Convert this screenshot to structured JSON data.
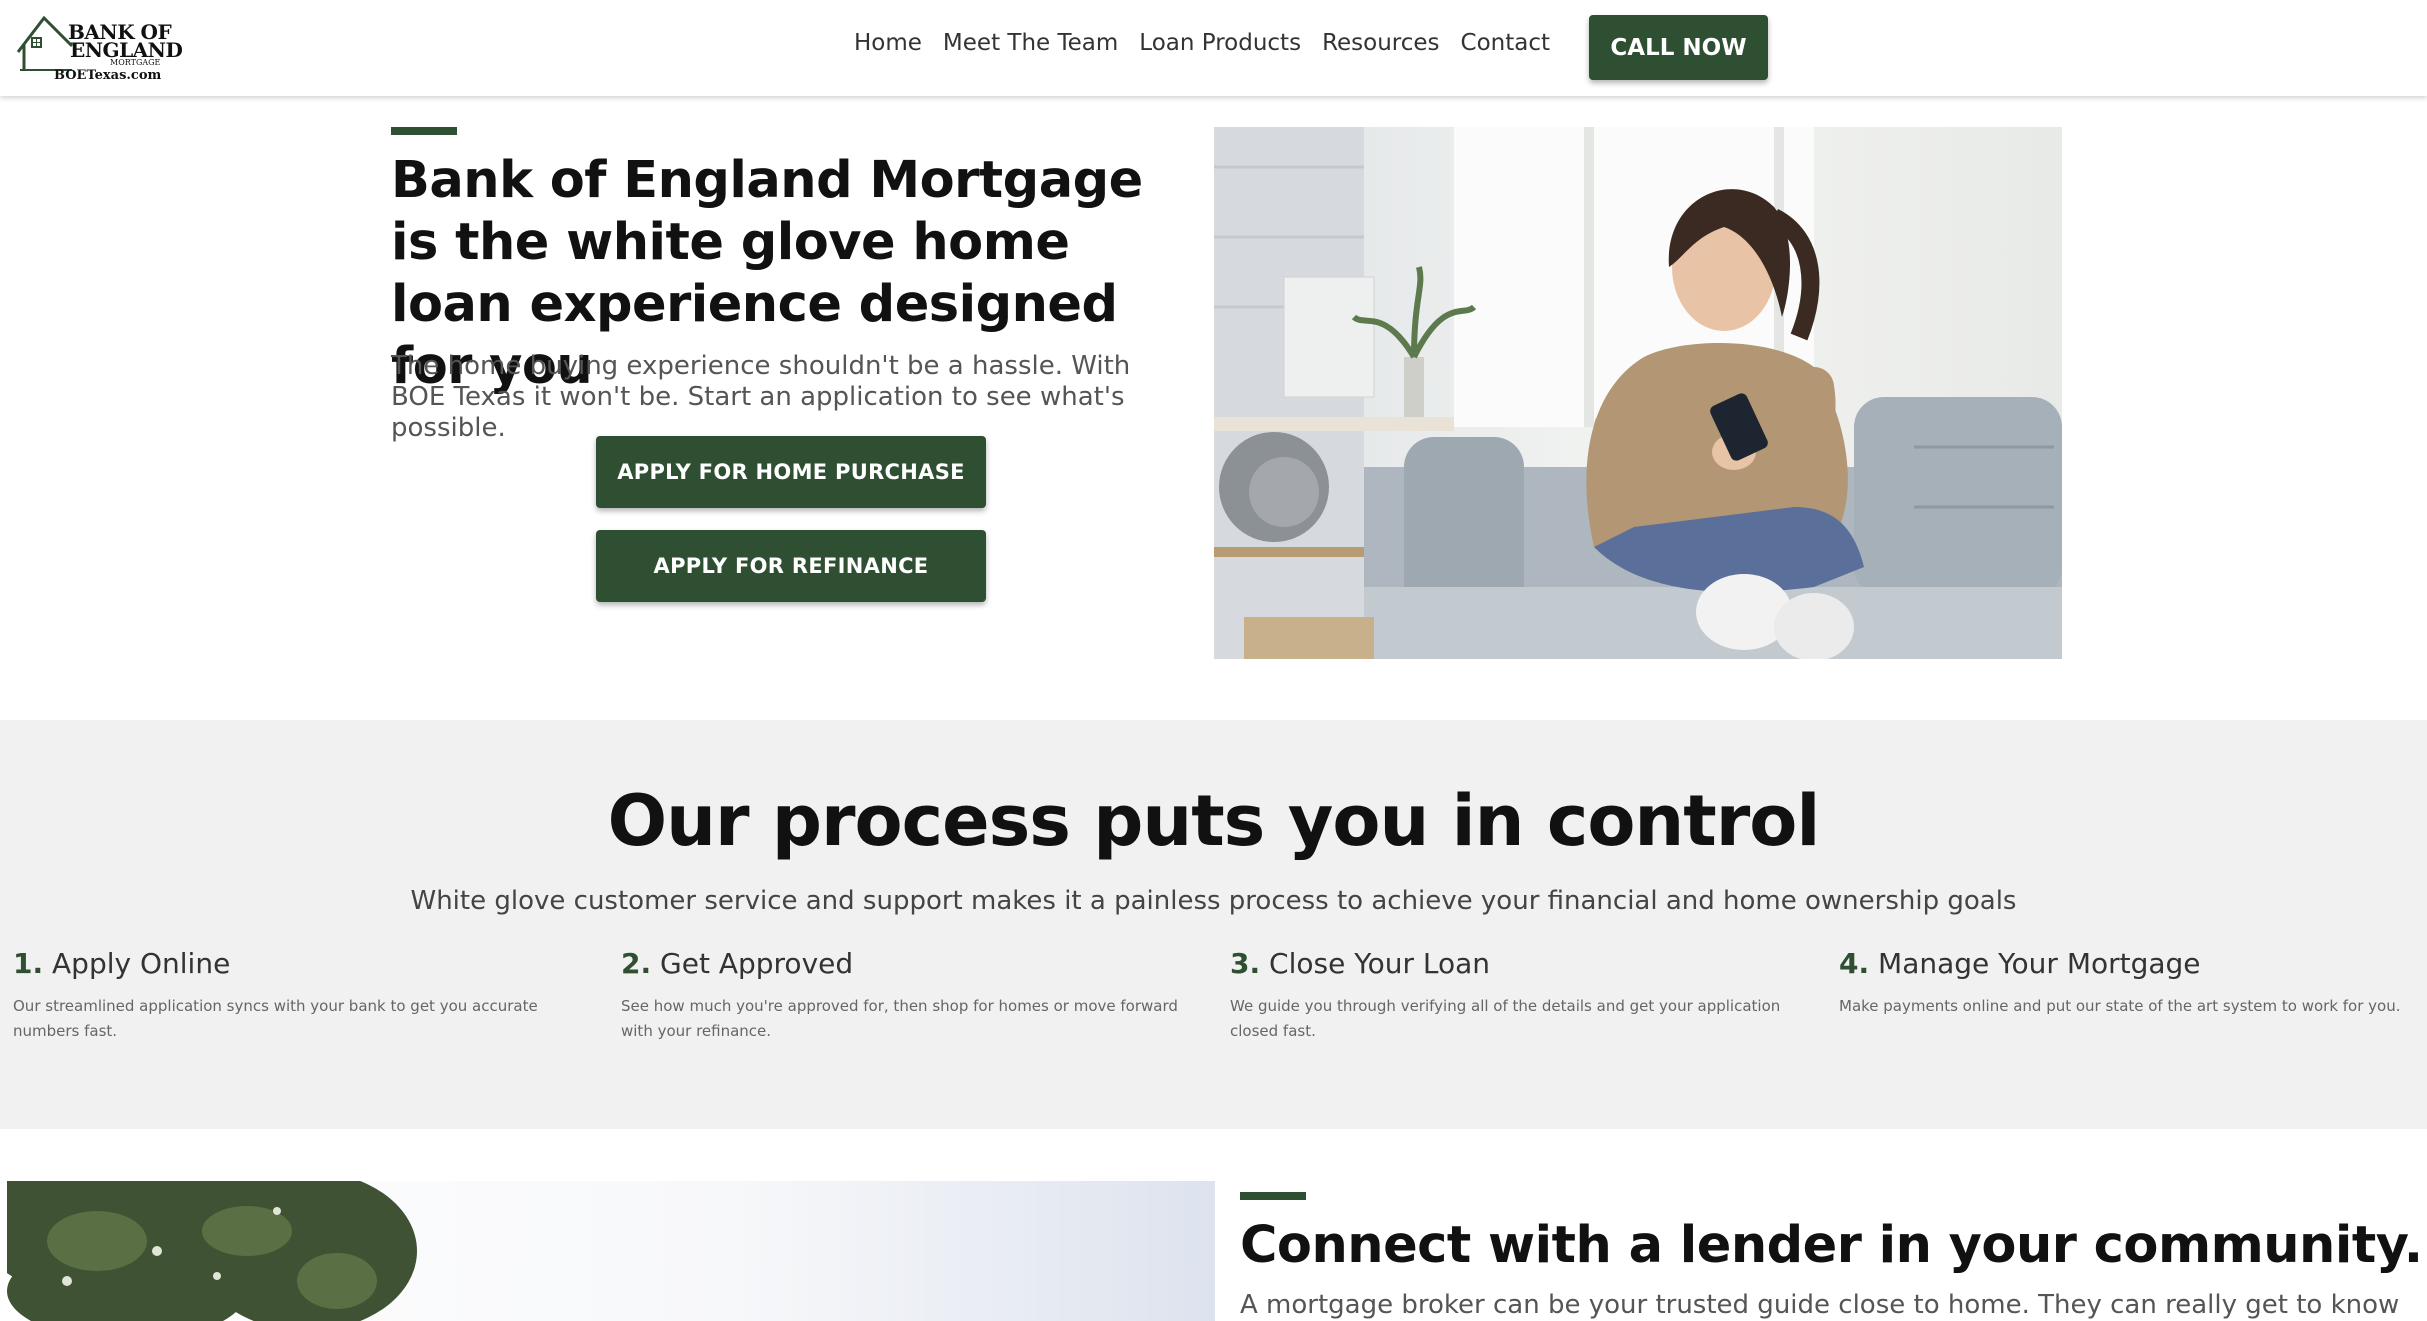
{
  "header": {
    "logo": {
      "line1": "BANK OF",
      "line2": "ENGLAND",
      "sub": "MORTGAGE",
      "url": "BOETexas.com"
    },
    "nav": [
      "Home",
      "Meet The Team",
      "Loan Products",
      "Resources",
      "Contact"
    ],
    "cta_label": "CALL NOW"
  },
  "hero": {
    "title": "Bank of England Mortgage is the white glove home loan experience designed for you",
    "subtitle": "The home buying experience shouldn't be a hassle. With BOE Texas it won't be. Start an application to see what's possible.",
    "buttons": [
      "APPLY FOR HOME PURCHASE",
      "APPLY FOR REFINANCE"
    ]
  },
  "process": {
    "title": "Our process puts you in control",
    "subtitle": "White glove customer service and support makes it a painless process to achieve your financial and home ownership goals",
    "steps": [
      {
        "num": "1.",
        "title": "Apply Online",
        "desc": "Our streamlined application syncs with your bank to get you accurate numbers fast."
      },
      {
        "num": "2.",
        "title": "Get Approved",
        "desc": "See how much you're approved for, then shop for homes or move forward with your refinance."
      },
      {
        "num": "3.",
        "title": "Close Your Loan",
        "desc": "We guide you through verifying all of the details and get your application closed fast."
      },
      {
        "num": "4.",
        "title": "Manage Your Mortgage",
        "desc": "Make payments online and put our state of the art system to work for you."
      }
    ]
  },
  "lender": {
    "title": "Connect with a lender in your community.",
    "subtitle": "A mortgage broker can be your trusted guide close to home. They can really get to know"
  },
  "colors": {
    "brand_green": "#2e4f31",
    "section_gray": "#f1f1f1"
  }
}
